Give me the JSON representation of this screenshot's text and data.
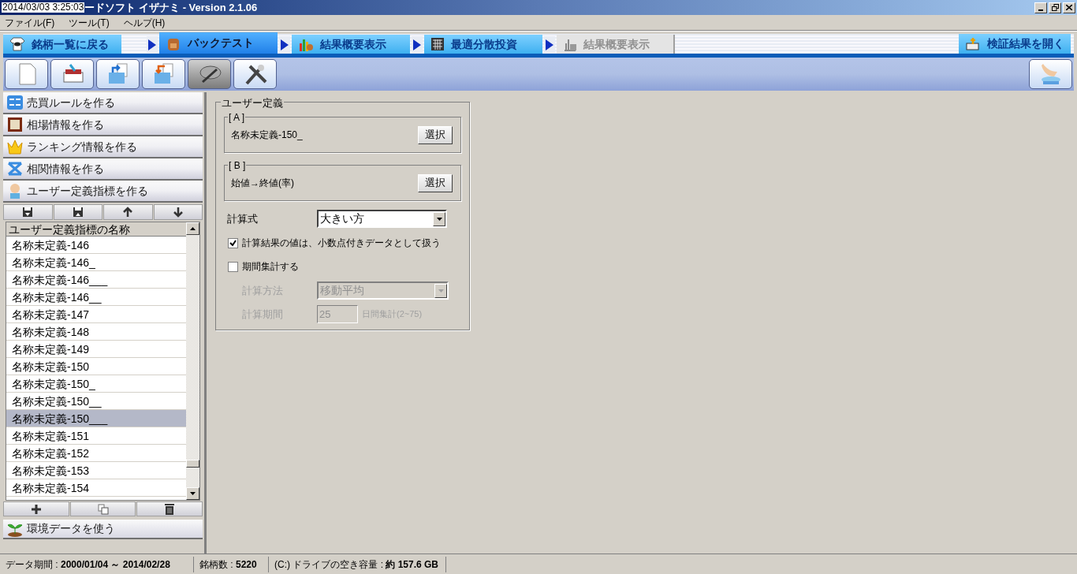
{
  "title_bar": {
    "clock": "2014/03/03 3:25:03",
    "title": "ードソフト イザナミ - Version 2.1.06"
  },
  "menu": [
    "ファイル(F)",
    "ツール(T)",
    "ヘルプ(H)"
  ],
  "tabs": [
    {
      "label": "銘柄一覧に戻る",
      "kind": "nav",
      "selected": false,
      "disabled": false
    },
    {
      "label": "バックテスト",
      "kind": "step",
      "selected": true,
      "disabled": false
    },
    {
      "label": "結果概要表示",
      "kind": "step",
      "selected": false,
      "disabled": false
    },
    {
      "label": "最適分散投資",
      "kind": "step",
      "selected": false,
      "disabled": false
    },
    {
      "label": "結果概要表示",
      "kind": "step",
      "selected": false,
      "disabled": true
    }
  ],
  "open_results": "検証結果を開く",
  "toolbar": [
    {
      "pressed": false
    },
    {
      "pressed": false
    },
    {
      "pressed": false
    },
    {
      "pressed": false
    },
    {
      "pressed": true
    },
    {
      "pressed": false
    }
  ],
  "sidebar": {
    "sections": [
      "売買ルールを作る",
      "相場情報を作る",
      "ランキング情報を作る",
      "相関情報を作る",
      "ユーザー定義指標を作る"
    ],
    "list_header": "ユーザー定義指標の名称",
    "rows": [
      {
        "label": "名称未定義-146",
        "selected": false
      },
      {
        "label": "名称未定義-146_",
        "selected": false
      },
      {
        "label": "名称未定義-146___",
        "selected": false
      },
      {
        "label": "名称未定義-146__",
        "selected": false
      },
      {
        "label": "名称未定義-147",
        "selected": false
      },
      {
        "label": "名称未定義-148",
        "selected": false
      },
      {
        "label": "名称未定義-149",
        "selected": false
      },
      {
        "label": "名称未定義-150",
        "selected": false
      },
      {
        "label": "名称未定義-150_",
        "selected": false
      },
      {
        "label": "名称未定義-150__",
        "selected": false
      },
      {
        "label": "名称未定義-150___",
        "selected": true
      },
      {
        "label": "名称未定義-151",
        "selected": false
      },
      {
        "label": "名称未定義-152",
        "selected": false
      },
      {
        "label": "名称未定義-153",
        "selected": false
      },
      {
        "label": "名称未定義-154",
        "selected": false
      }
    ],
    "bottom_section": "環境データを使う"
  },
  "form": {
    "title": "ユーザー定義",
    "operands": [
      {
        "legend": "[ A ]",
        "value": "名称未定義-150_",
        "button": "選択"
      },
      {
        "legend": "[ B ]",
        "value": "始値→終値(率)",
        "button": "選択"
      }
    ],
    "formula": {
      "label": "計算式",
      "value": "大きい方"
    },
    "checks": [
      {
        "label": "計算結果の値は、小数点付きデータとして扱う",
        "checked": true
      },
      {
        "label": "期間集計する",
        "checked": false
      }
    ],
    "method": {
      "label": "計算方法",
      "value": "移動平均",
      "disabled": true
    },
    "period": {
      "label": "計算期間",
      "value": "25",
      "suffix": "日間集計(2~75)",
      "disabled": true
    }
  },
  "status_bar": [
    "データ期間 : **2000/01/04 ～ 2014/02/28**",
    "銘柄数 : **5220**",
    "(C:) ドライブの空き容量 : **約 157.6 GB**"
  ]
}
